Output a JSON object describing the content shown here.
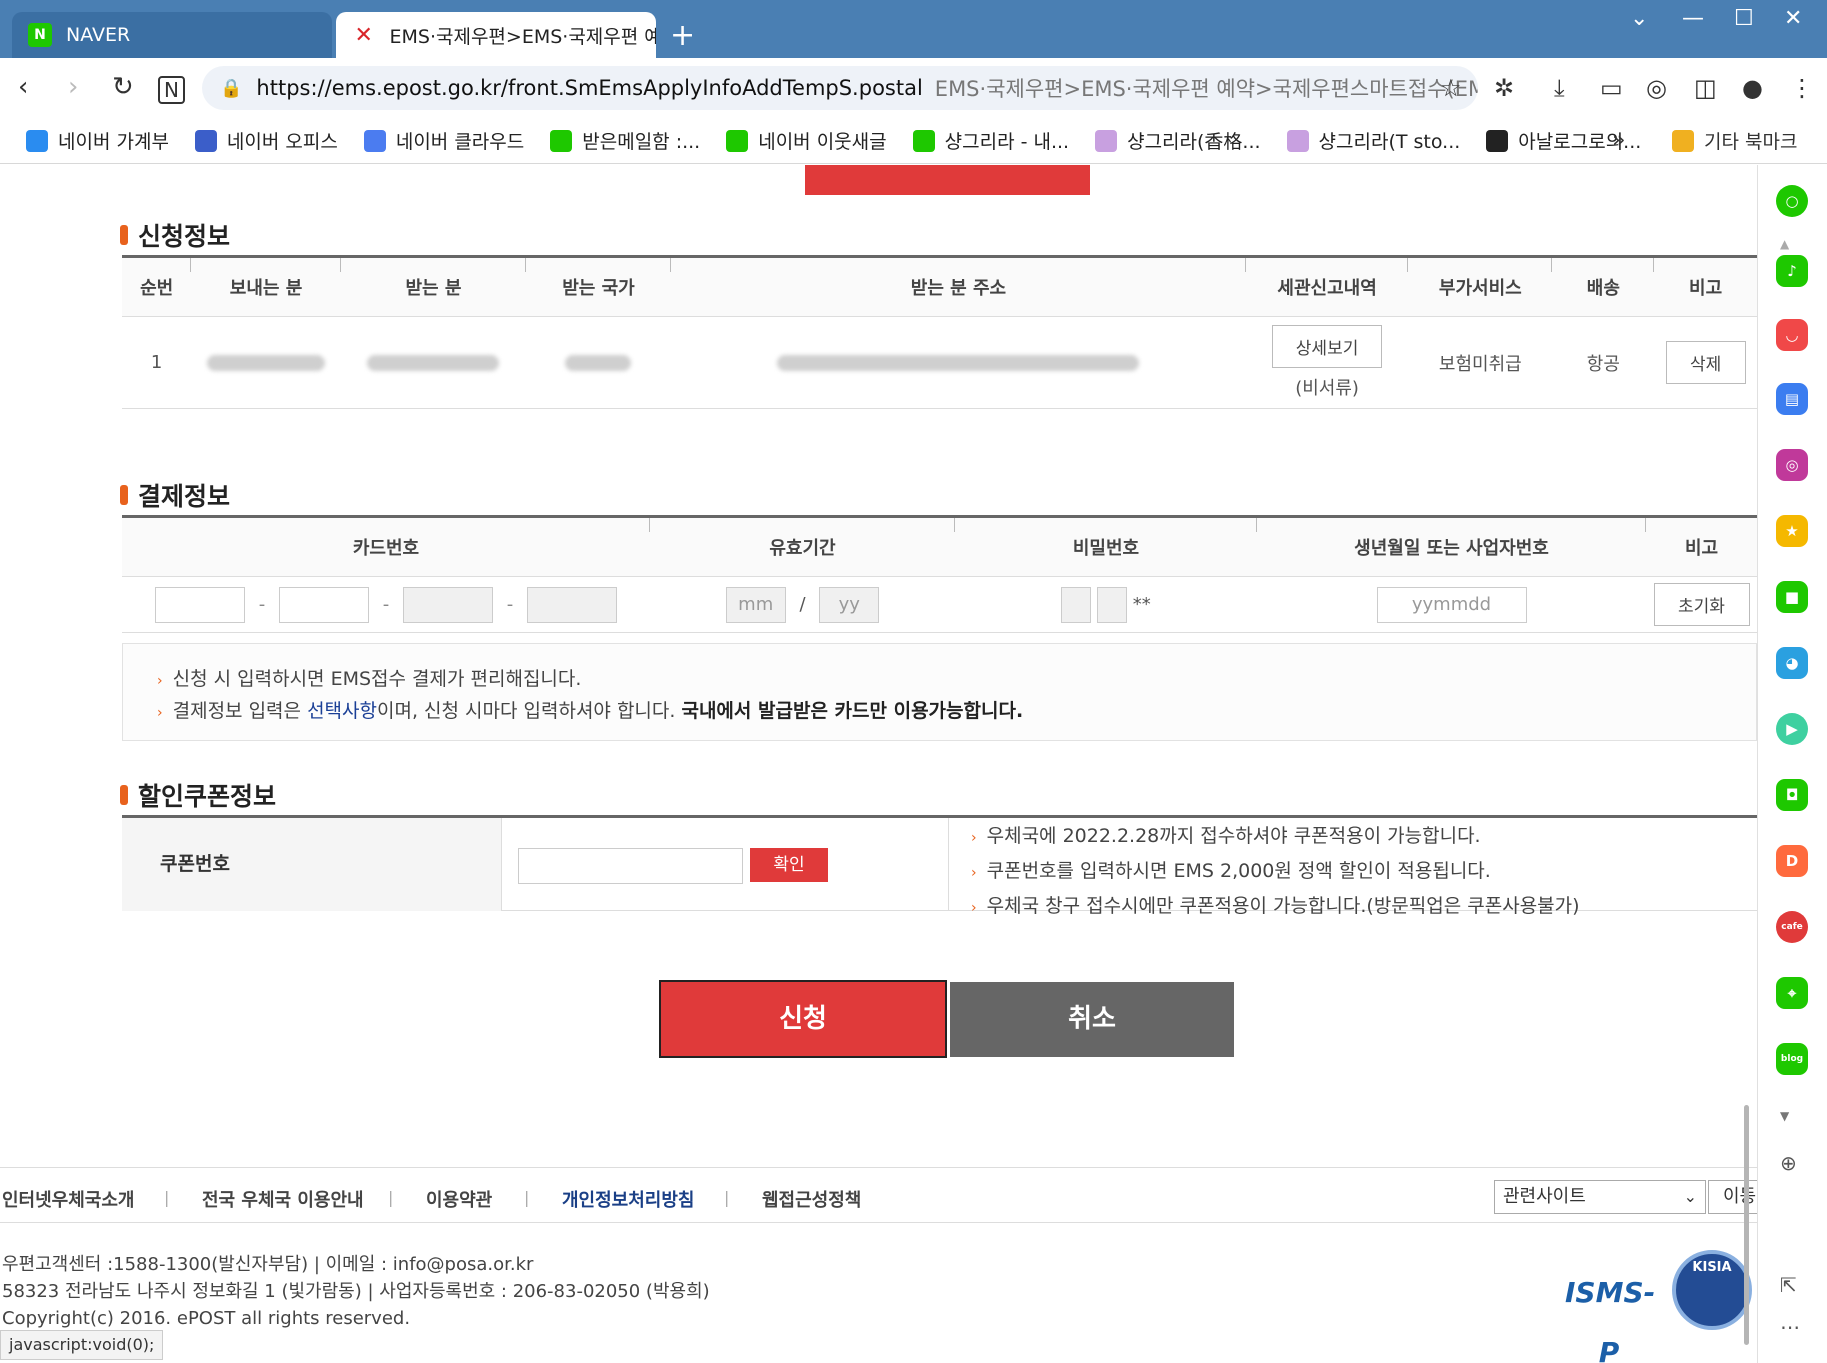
{
  "browser": {
    "tabs": [
      {
        "title": "NAVER",
        "favicon": "naver-icon"
      },
      {
        "title": "EMS·국제우편>EMS·국제우편 예",
        "favicon": "epost-icon"
      }
    ],
    "new_tab": "+",
    "url": "https://ems.epost.go.kr/front.SmEmsApplyInfoAddTempS.postal",
    "url_title": "EMS·국제우편>EMS·국제우편 예약>국제우편스마트접수(EM",
    "bookmarks": [
      {
        "label": "네이버 가계부",
        "color": "#2a8cf0"
      },
      {
        "label": "네이버 오피스",
        "color": "#3b5ec9"
      },
      {
        "label": "네이버 클라우드",
        "color": "#4b7cf0"
      },
      {
        "label": "받은메일함 :...",
        "color": "#1ec800"
      },
      {
        "label": "네이버 이웃새글",
        "color": "#1ec800"
      },
      {
        "label": "샹그리라 - 내...",
        "color": "#1ec800"
      },
      {
        "label": "샹그리라(香格...",
        "color": "#c8a0e0"
      },
      {
        "label": "샹그리라(T sto...",
        "color": "#c8a0e0"
      },
      {
        "label": "아날로그로의...",
        "color": "#222222"
      }
    ],
    "bookmarks_more": "»",
    "other_bookmarks": "기타 북마크"
  },
  "application": {
    "title": "신청정보",
    "columns": [
      "순번",
      "보내는 분",
      "받는 분",
      "받는 국가",
      "받는 분 주소",
      "세관신고내역",
      "부가서비스",
      "배송",
      "비고"
    ],
    "row": {
      "no": "1",
      "detail_button": "상세보기",
      "detail_note": "(비서류)",
      "service": "보험미취급",
      "delivery": "항공",
      "delete_button": "삭제"
    }
  },
  "payment": {
    "title": "결제정보",
    "columns": [
      "카드번호",
      "유효기간",
      "비밀번호",
      "생년월일 또는 사업자번호",
      "비고"
    ],
    "mm_placeholder": "mm",
    "yy_placeholder": "yy",
    "slash": "/",
    "pw_suffix": "**",
    "birth_placeholder": "yymmdd",
    "reset_button": "초기화",
    "notes": {
      "line1": "신청 시 입력하시면 EMS접수 결제가 편리해집니다.",
      "line2_a": "결제정보 입력은 ",
      "line2_link": "선택사항",
      "line2_b": "이며, 신청 시마다 입력하셔야 합니다. ",
      "line2_bold": "국내에서 발급받은 카드만 이용가능합니다."
    }
  },
  "coupon": {
    "title": "할인쿠폰정보",
    "label": "쿠폰번호",
    "confirm_button": "확인",
    "notes": [
      "우체국에 2022.2.28까지 접수하셔야 쿠폰적용이 가능합니다.",
      "쿠폰번호를 입력하시면 EMS 2,000원 정액 할인이 적용됩니다.",
      "우체국 창구 접수시에만 쿠폰적용이 가능합니다.(방문픽업은 쿠폰사용불가)"
    ]
  },
  "actions": {
    "apply": "신청",
    "cancel": "취소"
  },
  "footer": {
    "links": [
      "인터넷우체국소개",
      "전국 우체국 이용안내",
      "이용약관",
      "개인정보처리방침",
      "웹접근성정책"
    ],
    "related_select": "관련사이트",
    "go_button": "이동",
    "info_lines": [
      "우편고객센터 :1588-1300(발신자부담)  |  이메일 : info@posa.or.kr",
      "58323 전라남도 나주시 정보화길 1 (빛가람동)  |  사업자등록번호 : 206-83-02050 (박용희)",
      "Copyright(c) 2016. ePOST all rights reserved."
    ],
    "badge1": "ISMS-P",
    "badge2": "KISIA"
  },
  "status_bar": "javascript:void(0);",
  "colors": {
    "accent_red": "#e03a3a",
    "section_mark": "#e8621d",
    "naver_green": "#1ec800"
  }
}
